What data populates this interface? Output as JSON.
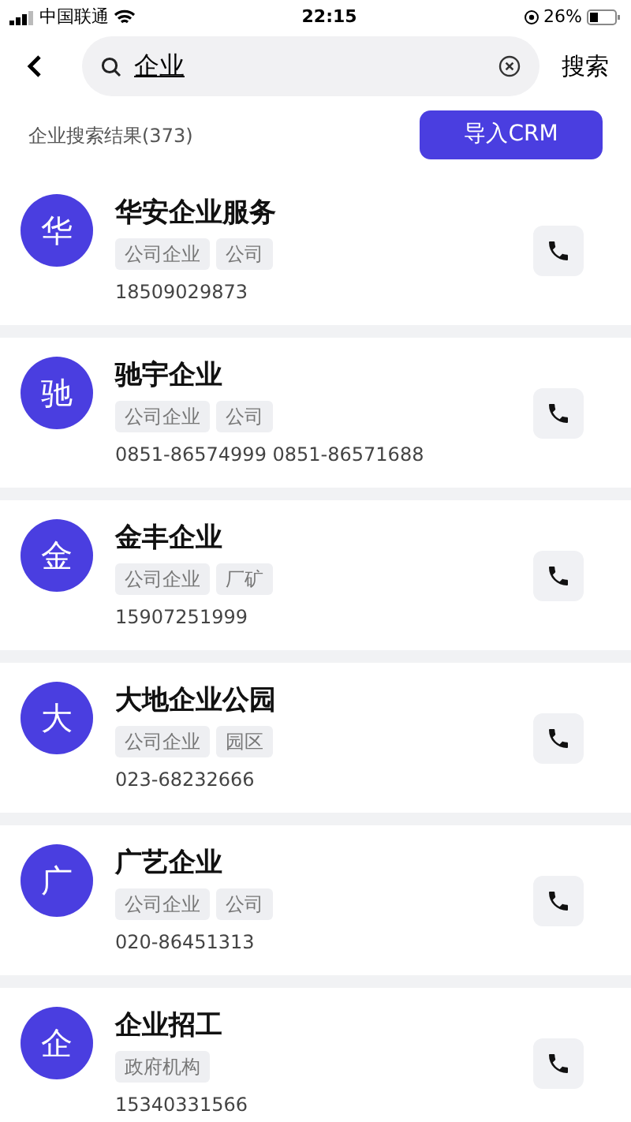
{
  "status_bar": {
    "carrier": "中国联通",
    "time": "22:15",
    "battery": "26%"
  },
  "search": {
    "value": "企业",
    "button": "搜索"
  },
  "results": {
    "summary": "企业搜索结果(373)",
    "import_button": "导入CRM"
  },
  "companies": [
    {
      "avatar": "华",
      "name": "华安企业服务",
      "tags": [
        "公司企业",
        "公司"
      ],
      "phone": "18509029873"
    },
    {
      "avatar": "驰",
      "name": "驰宇企业",
      "tags": [
        "公司企业",
        "公司"
      ],
      "phone": "0851-86574999 0851-86571688"
    },
    {
      "avatar": "金",
      "name": "金丰企业",
      "tags": [
        "公司企业",
        "厂矿"
      ],
      "phone": "15907251999"
    },
    {
      "avatar": "大",
      "name": "大地企业公园",
      "tags": [
        "公司企业",
        "园区"
      ],
      "phone": "023-68232666"
    },
    {
      "avatar": "广",
      "name": "广艺企业",
      "tags": [
        "公司企业",
        "公司"
      ],
      "phone": "020-86451313"
    },
    {
      "avatar": "企",
      "name": "企业招工",
      "tags": [
        "政府机构"
      ],
      "phone": "15340331566"
    }
  ]
}
